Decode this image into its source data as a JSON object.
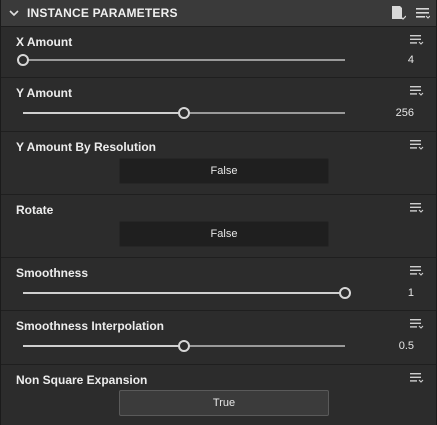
{
  "header": {
    "title": "INSTANCE PARAMETERS"
  },
  "params": {
    "x_amount": {
      "label": "X Amount",
      "value": "4",
      "fraction": 0.0
    },
    "y_amount": {
      "label": "Y Amount",
      "value": "256",
      "fraction": 0.5
    },
    "y_by_res": {
      "label": "Y Amount By Resolution",
      "value": "False"
    },
    "rotate": {
      "label": "Rotate",
      "value": "False"
    },
    "smoothness": {
      "label": "Smoothness",
      "value": "1",
      "fraction": 1.0
    },
    "smooth_interp": {
      "label": "Smoothness Interpolation",
      "value": "0.5",
      "fraction": 0.5
    },
    "non_square": {
      "label": "Non Square Expansion",
      "value": "True"
    }
  },
  "icons": {
    "collapse": "chevron-down-icon",
    "header_doc": "document-dropdown-icon",
    "header_menu": "menu-lines-icon",
    "param_menu": "param-options-icon"
  },
  "colors": {
    "background": "#2c2c2c",
    "header": "#3a3a3a",
    "toggle_off": "#1f1f1f",
    "toggle_on": "#3b3b3b"
  }
}
